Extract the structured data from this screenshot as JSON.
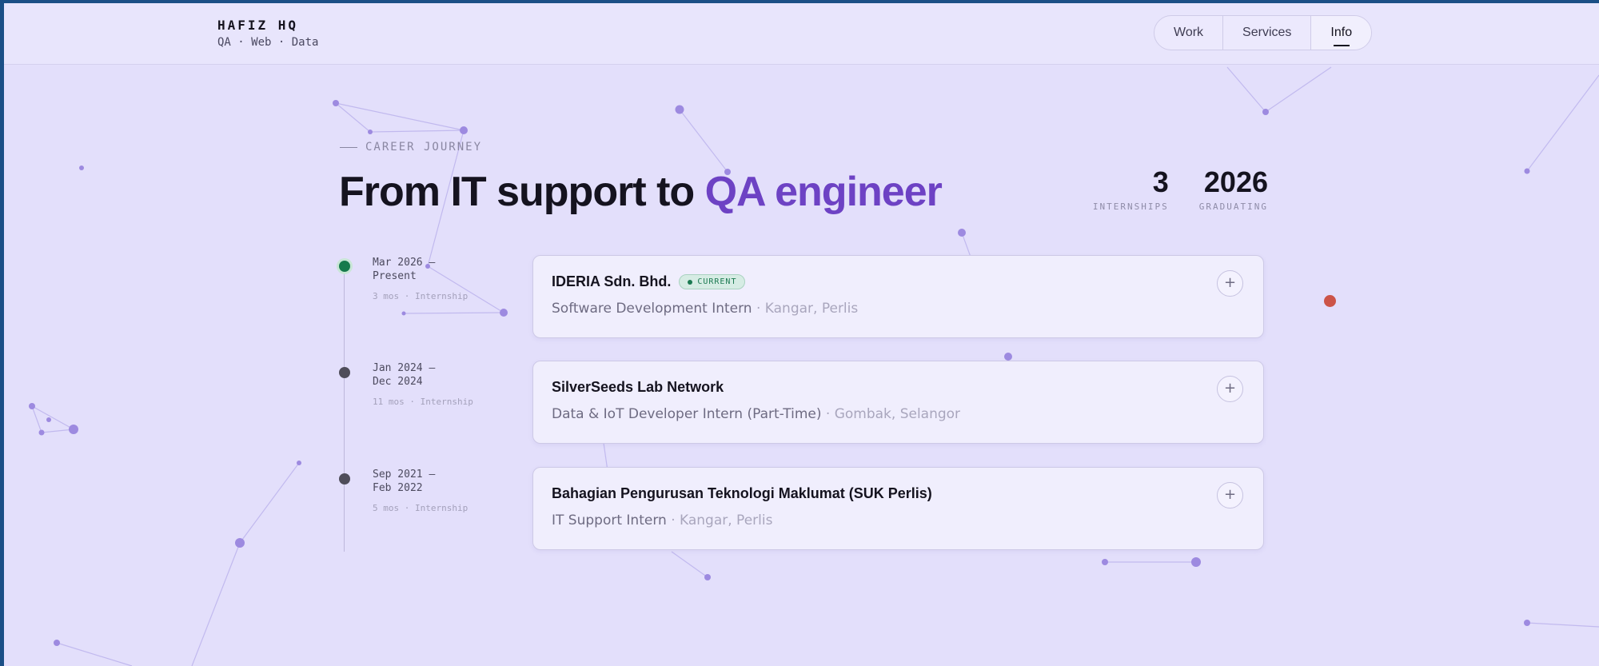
{
  "brand": {
    "title": "HAFIZ HQ",
    "subtitle": "QA · Web · Data"
  },
  "nav": {
    "tabs": [
      {
        "label": "Work"
      },
      {
        "label": "Services"
      },
      {
        "label": "Info",
        "active": true
      }
    ]
  },
  "hero": {
    "eyebrow": "CAREER JOURNEY",
    "headline_plain": "From IT support to ",
    "headline_accent": "QA engineer",
    "accent_color": "#6d42c4"
  },
  "stats": [
    {
      "value": "3",
      "label": "INTERNSHIPS"
    },
    {
      "value": "2026",
      "label": "GRADUATING"
    }
  ],
  "timeline": [
    {
      "date_range_1": "Mar 2026 —",
      "date_range_2": "Present",
      "meta": "3 mos · Internship",
      "company": "IDERIA Sdn. Bhd.",
      "badge": "CURRENT",
      "role": "Software Development Intern",
      "location": "· Kangar, Perlis",
      "status": "current"
    },
    {
      "date_range_1": "Jan 2024 —",
      "date_range_2": "Dec 2024",
      "meta": "11 mos · Internship",
      "company": "SilverSeeds Lab Network",
      "role": "Data & IoT Developer Intern (Part-Time)",
      "location": "· Gombak, Selangor",
      "status": "past"
    },
    {
      "date_range_1": "Sep 2021 —",
      "date_range_2": "Feb 2022",
      "meta": "5 mos · Internship",
      "company": "Bahagian Pengurusan Teknologi Maklumat (SUK Perlis)",
      "role": "IT Support Intern",
      "location": "· Kangar, Perlis",
      "status": "past"
    }
  ],
  "icons": {
    "expand": "plus-icon",
    "current_dot": "status-dot-icon"
  },
  "colors": {
    "current_green": "#167a4c",
    "past_gray": "#4f4d5a",
    "page_bg": "#e3dffb"
  }
}
